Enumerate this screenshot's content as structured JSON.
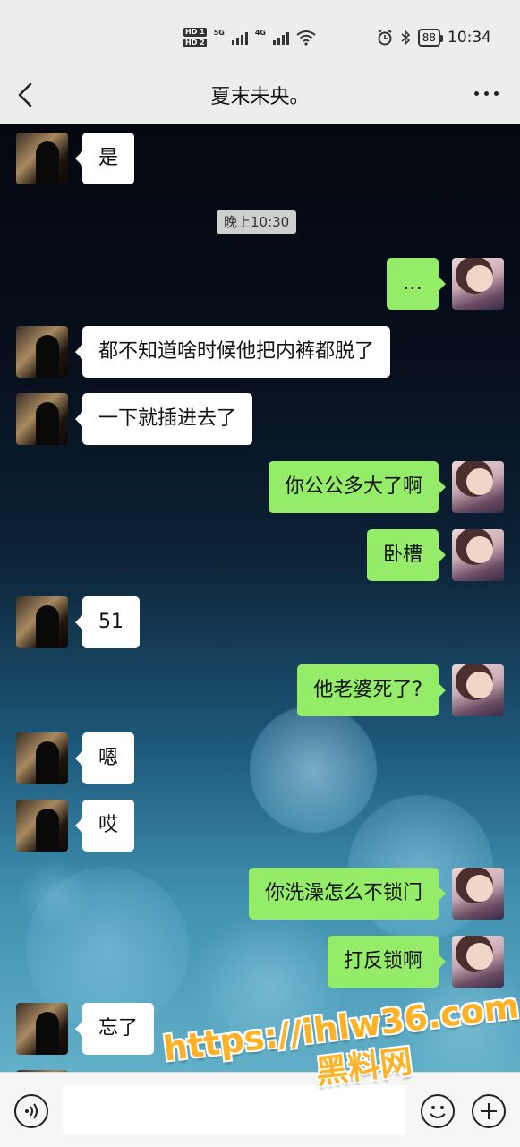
{
  "status_bar": {
    "sim1_label": "HD 1",
    "sim2_label": "HD 2",
    "net1": "5G",
    "net2": "4G",
    "battery": "88",
    "time": "10:34"
  },
  "header": {
    "title": "夏末未央。"
  },
  "timestamp": "晚上10:30",
  "messages": [
    {
      "from": "them",
      "text": "是"
    },
    {
      "from": "me",
      "text": "…"
    },
    {
      "from": "them",
      "text": "都不知道啥时候他把内裤都脱了"
    },
    {
      "from": "them",
      "text": "一下就插进去了"
    },
    {
      "from": "me",
      "text": "你公公多大了啊"
    },
    {
      "from": "me",
      "text": "卧槽"
    },
    {
      "from": "them",
      "text": "51"
    },
    {
      "from": "me",
      "text": "他老婆死了?"
    },
    {
      "from": "them",
      "text": "嗯"
    },
    {
      "from": "them",
      "text": "哎"
    },
    {
      "from": "me",
      "text": "你洗澡怎么不锁门"
    },
    {
      "from": "me",
      "text": "打反锁啊"
    },
    {
      "from": "them",
      "text": "忘了"
    }
  ],
  "watermark": {
    "url": "https://ihlw36.com",
    "name": "黑料网"
  },
  "colors": {
    "my_bubble": "#95ec69",
    "their_bubble": "#ffffff",
    "bar_background": "#ededed"
  }
}
